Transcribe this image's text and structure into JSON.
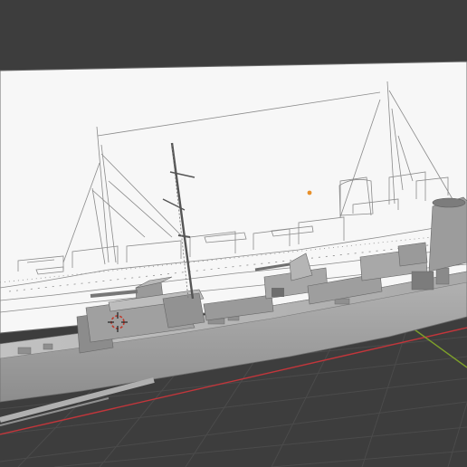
{
  "app": {
    "name": ""
  },
  "viewport": {
    "background_color": "#3d3d3d",
    "grid_line_color": "#4b4b4b",
    "grid_x_axis_color": "#c2363b",
    "grid_y_axis_color": "#7ea02a"
  },
  "reference_image": {
    "description_icon": "blueprint-icon",
    "paper_color": "#f7f7f7",
    "line_color": "#8a8a8a"
  },
  "model": {
    "icon": "warship-model-icon",
    "hull_color": "#a6a6a6",
    "dark_color": "#5e5e5e",
    "shadow_color": "#7c7c7c"
  },
  "origin_marker": {
    "icon": "origin-point-icon",
    "color": "#e8902a"
  },
  "cursor_3d": {
    "icon": "3d-cursor-icon",
    "color": "#c0392b"
  }
}
